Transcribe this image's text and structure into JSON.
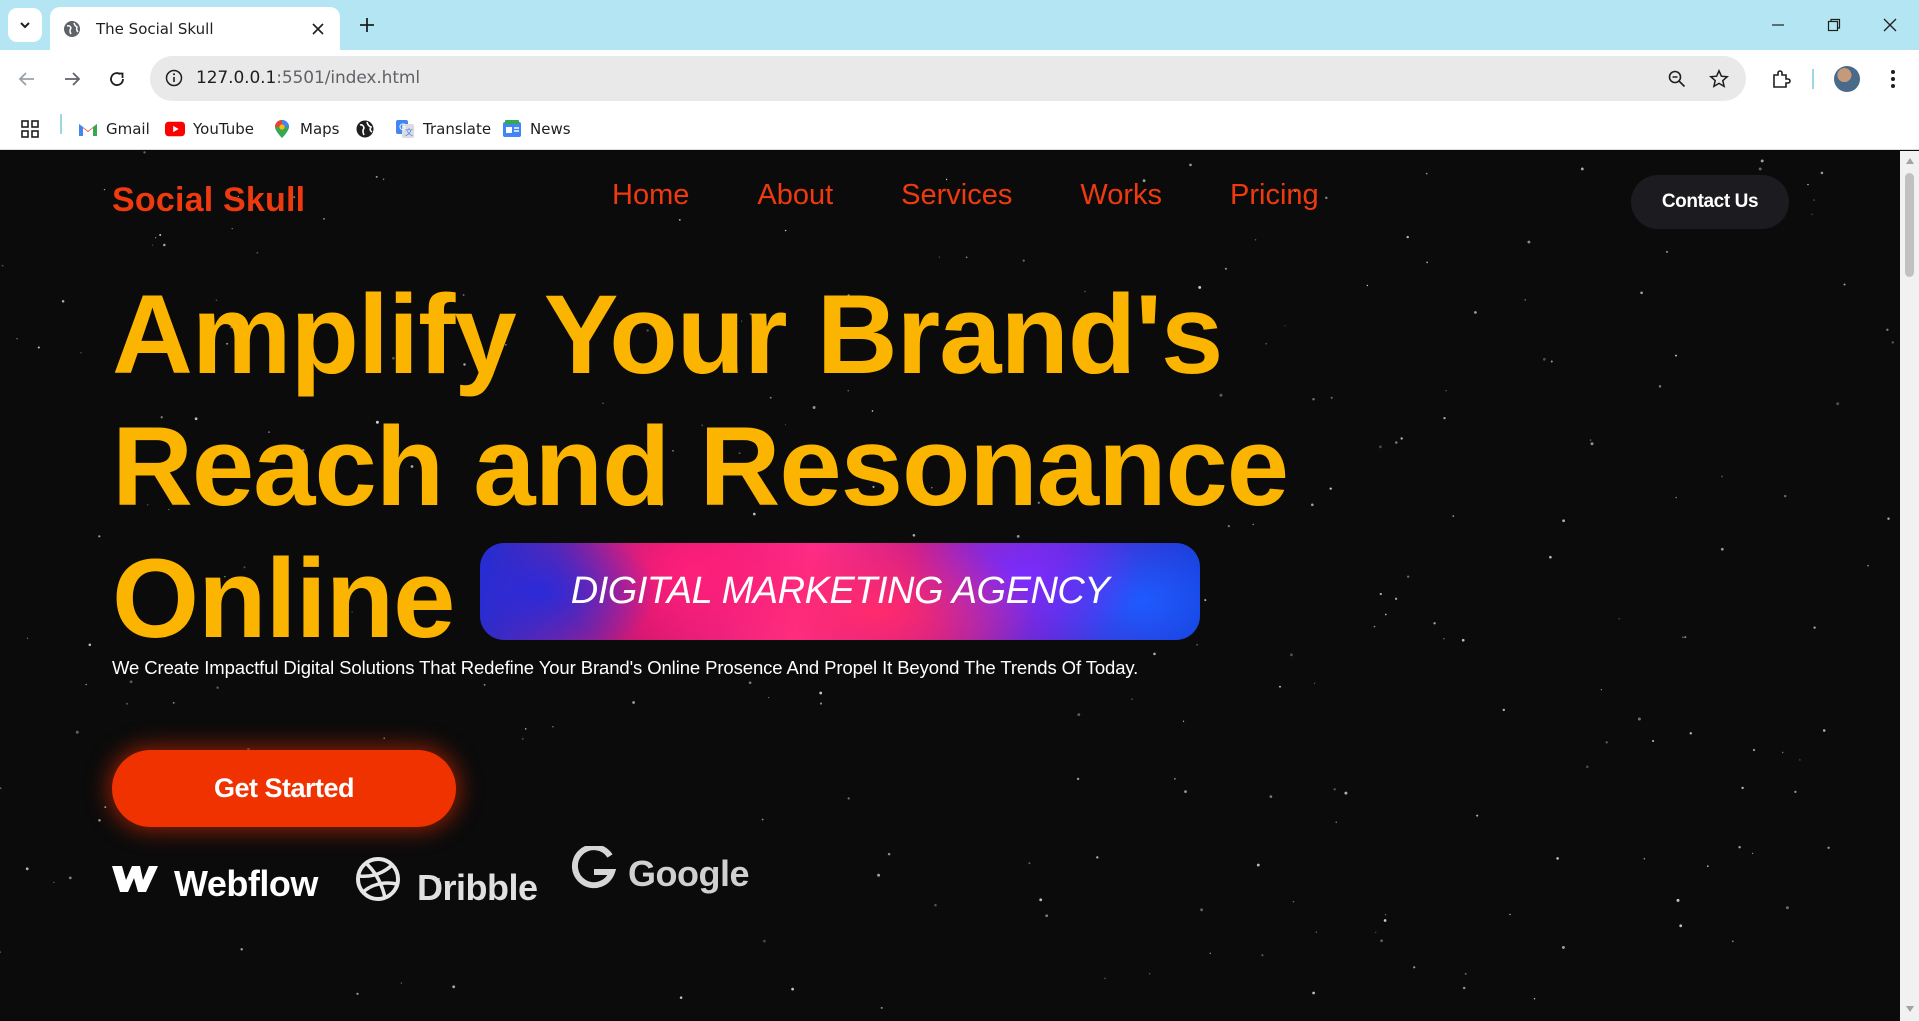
{
  "browser": {
    "tab_title": "The Social Skull",
    "url_host": "127.0.0.1",
    "url_rest": ":5501/index.html",
    "bookmarks": [
      {
        "label": "Gmail",
        "icon": "gmail-icon"
      },
      {
        "label": "YouTube",
        "icon": "youtube-icon"
      },
      {
        "label": "Maps",
        "icon": "maps-icon"
      },
      {
        "label": "",
        "icon": "globe-icon"
      },
      {
        "label": "Translate",
        "icon": "translate-icon"
      },
      {
        "label": "News",
        "icon": "news-icon"
      }
    ]
  },
  "page": {
    "logo": "Social Skull",
    "nav": [
      "Home",
      "About",
      "Services",
      "Works",
      "Pricing"
    ],
    "contact_label": "Contact Us",
    "hero_lines": [
      "Amplify Your Brand's",
      "Reach and Resonance",
      "Online"
    ],
    "badge": "DIGITAL MARKETING AGENCY",
    "tagline": "We Create Impactful Digital Solutions That Redefine Your Brand's Online Prosence And Propel It Beyond The Trends Of Today.",
    "cta_label": "Get Started",
    "brands": [
      "Webflow",
      "Dribble",
      "Google"
    ]
  },
  "colors": {
    "accent": "#ef3a0f",
    "headline": "#fbb400",
    "background": "#0b0b0b",
    "tabstrip": "#b3e6f2"
  }
}
